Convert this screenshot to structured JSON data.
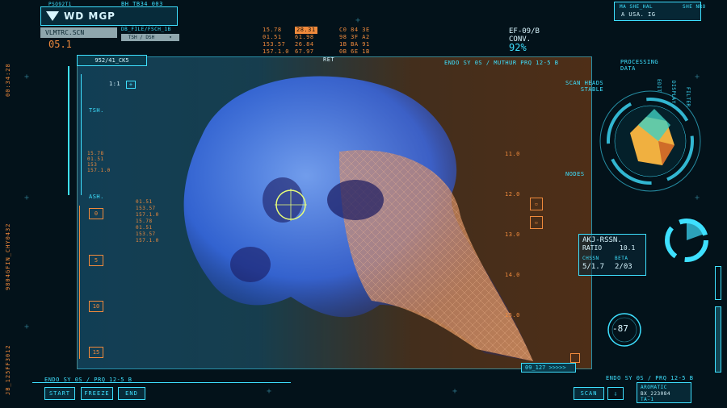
{
  "header": {
    "tiny_id": "PSO92T1",
    "logo_text": "WD MGP",
    "file_code": "BH_TB34_003",
    "scene_file": "VLMTRC.SCN",
    "scene_path": "DB_FILE/FSCH_1B",
    "view_mode": "TSH / DSH",
    "section_no": "05.1"
  },
  "top_numbers": {
    "col1": [
      "15.78",
      "01.51",
      "153.57",
      "157.1.0"
    ],
    "col2": [
      "28.31",
      "61.98",
      "26.84",
      "67.97"
    ],
    "col3": [
      "C0 84 3E",
      "98 3F A2",
      "1B BA 91",
      "0B 6E 1B"
    ]
  },
  "conv": {
    "code": "EF-09/B",
    "label": "CONV.",
    "percent": "92%"
  },
  "top_right": {
    "small_label": "MA SHE_HAL",
    "right_small": "SHE NRO",
    "region": "A USA. IG"
  },
  "panel": {
    "tab": "952/41_CK5",
    "ret": "RET",
    "title": "ENDO SY 0S / MUTHUR PRQ 12-5 B",
    "scan_status_1": "SCAN HEADS",
    "scan_status_2": "STABLE",
    "ratio_label": "1:1",
    "label_tsh": "TSH.",
    "label_ash": "ASH.",
    "side_values": [
      "15.78",
      "01.51",
      "153",
      "157.1.0"
    ],
    "readouts": [
      "01.51",
      "153.57",
      "157.1.0",
      "15.78",
      "01.51",
      "153.57",
      "157.1.0"
    ],
    "scale": [
      "0",
      "5",
      "10",
      "15"
    ],
    "right_scale": [
      "11.0",
      "12.0",
      "13.0",
      "14.0",
      "15.0"
    ],
    "nodes_label": "NODES",
    "bottom_tag": "09_127 >>>>>"
  },
  "left_vertical": [
    "00:34:28",
    "9804GFIN_CHY0432",
    "JB_125FF3012"
  ],
  "right_panel": {
    "processing_1": "PROCESSING",
    "processing_2": "DATA",
    "ring_labels": [
      "EDIT",
      "DISPLAY",
      "FILTER"
    ],
    "ratio_title": "AKJ-RSSN.",
    "ratio_sub": "RATIO",
    "ratio_val": "10.1",
    "chsn_label": "CHSSN",
    "beta_label": "BETA",
    "val_a": "5/1.7",
    "val_b": "2/03",
    "dial_value": "-87"
  },
  "bottom_bar": {
    "left_caption": "ENDO SY 0S / PRQ 12-5 B",
    "start": "START",
    "freeze": "FREEZE",
    "end": "END",
    "right_caption": "ENDO SY 0S / PRQ 12-5 B",
    "scan": "SCAN",
    "aromatic": "AROMATIC",
    "aromatic_sub": "BX_223084",
    "aromatic_sub2": "TA-1"
  },
  "colors": {
    "cyan": "#3ee0ff",
    "orange": "#f08a3c",
    "background": "#03121a"
  }
}
